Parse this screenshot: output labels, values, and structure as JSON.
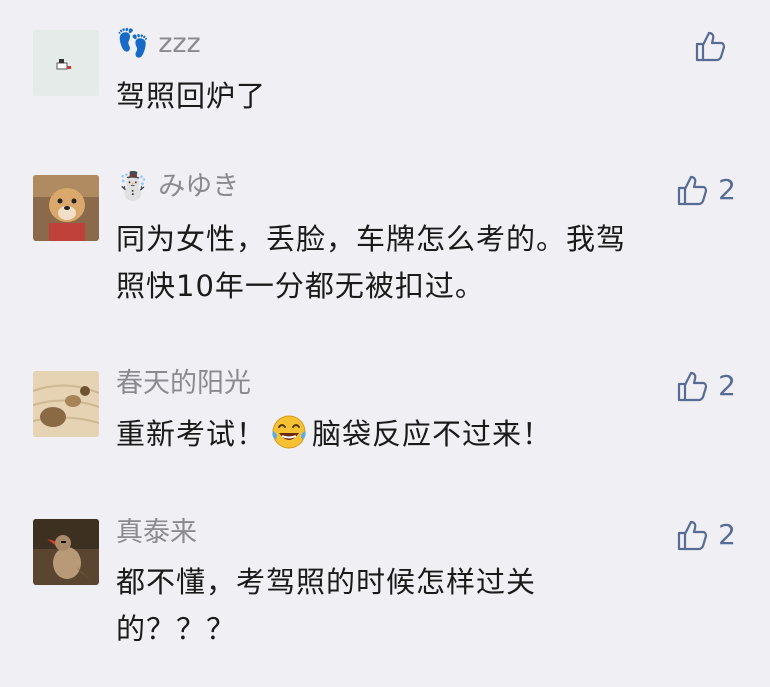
{
  "comments": [
    {
      "name": "👣 zzz",
      "lines": [
        "驾照回炉了"
      ],
      "likes": ""
    },
    {
      "name": "☃️ みゆき",
      "lines": [
        "同为女性，丢脸，车牌怎么考的。我驾",
        "照快10年一分都无被扣过。"
      ],
      "likes": "2"
    },
    {
      "name": "春天的阳光",
      "line_before": "重新考试！",
      "line_after": "脑袋反应不过来！",
      "likes": "2"
    },
    {
      "name": "真泰来",
      "lines": [
        "都不懂，考驾照的时候怎样过关",
        "的？？？"
      ],
      "likes": "2"
    }
  ],
  "icons": {
    "like": "thumbs-up-icon",
    "laugh": "tears-of-joy-emoji"
  },
  "colors": {
    "background": "#efeff4",
    "like": "#576b95",
    "name": "#8a8a8f",
    "text": "#1a1a1a"
  }
}
